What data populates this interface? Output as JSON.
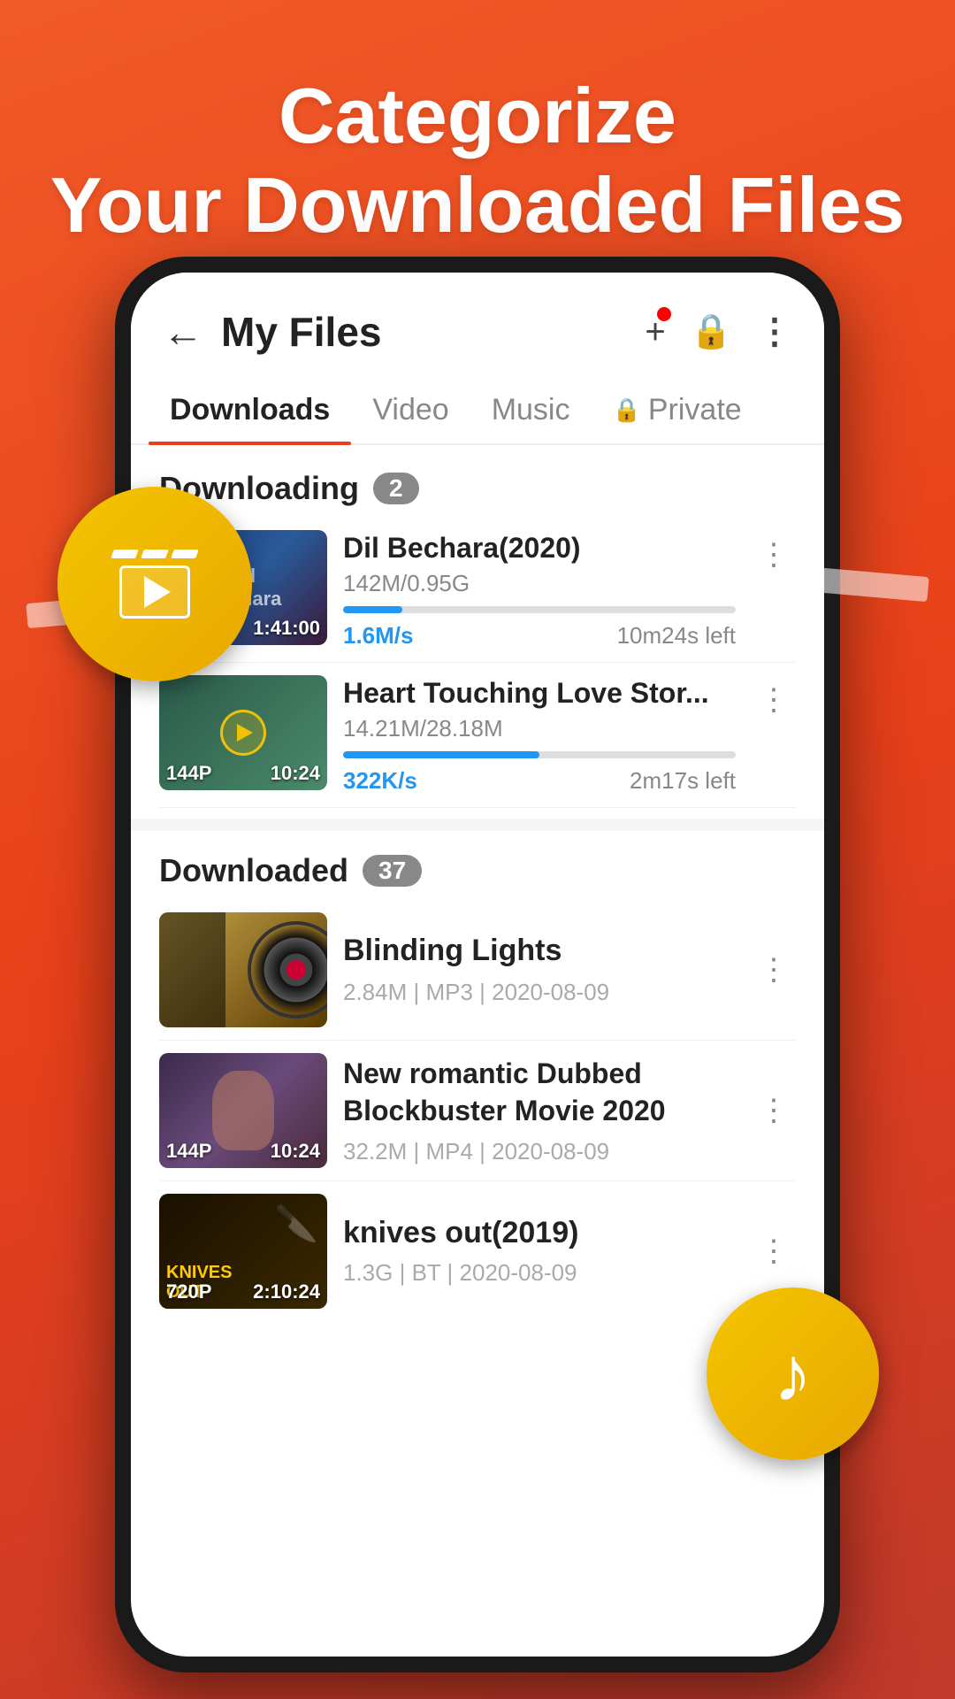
{
  "hero": {
    "line1": "Categorize",
    "line2": "Your Downloaded Files"
  },
  "header": {
    "title": "My Files",
    "back_icon": "←",
    "add_icon": "+",
    "lock_icon": "🔒",
    "more_icon": "⋮"
  },
  "tabs": [
    {
      "label": "Downloads",
      "active": true
    },
    {
      "label": "Video",
      "active": false
    },
    {
      "label": "Music",
      "active": false
    },
    {
      "label": "Private",
      "active": false,
      "has_lock": true
    }
  ],
  "downloading_section": {
    "title": "Downloading",
    "count": 2,
    "items": [
      {
        "title": "Dil Bechara(2020)",
        "size": "142M/0.95G",
        "progress_pct": 15,
        "speed": "1.6M/s",
        "time_left": "10m24s left",
        "duration": "1:41:00",
        "thumb_type": "dil"
      },
      {
        "title": "Heart Touching Love Stor...",
        "size": "14.21M/28.18M",
        "progress_pct": 50,
        "speed": "322K/s",
        "time_left": "2m17s left",
        "quality": "144P",
        "duration": "10:24",
        "thumb_type": "heart"
      }
    ]
  },
  "downloaded_section": {
    "title": "Downloaded",
    "count": 37,
    "items": [
      {
        "title": "Blinding Lights",
        "meta": "2.84M | MP3 | 2020-08-09",
        "thumb_type": "music"
      },
      {
        "title": "New romantic Dubbed Blockbuster Movie  2020",
        "meta": "32.2M | MP4 | 2020-08-09",
        "quality": "144P",
        "duration": "10:24",
        "thumb_type": "romance"
      },
      {
        "title": "knives out(2019)",
        "meta": "1.3G | BT | 2020-08-09",
        "quality": "720P",
        "duration": "2:10:24",
        "thumb_type": "knives"
      }
    ]
  },
  "floating": {
    "clapperboard_label": "clapperboard",
    "music_label": "music-note"
  }
}
